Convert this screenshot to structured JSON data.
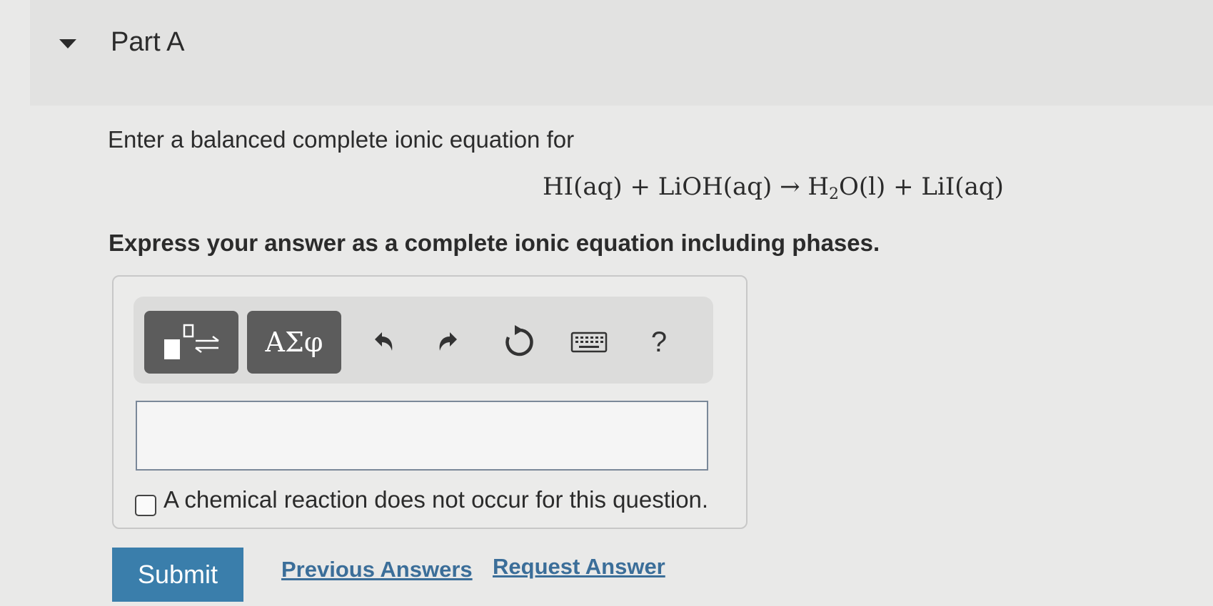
{
  "part": {
    "title": "Part A"
  },
  "question": {
    "prompt": "Enter a balanced complete ionic equation for",
    "equation": {
      "before_sub": "HI(aq) + LiOH(aq) → H",
      "subscript": "2",
      "after_sub": "O(l) + LiI(aq)"
    },
    "instruction": "Express your answer as a complete ionic equation including phases."
  },
  "toolbar": {
    "symbols_label": "ΑΣφ",
    "help_label": "?",
    "icons": [
      "templates-icon",
      "undo-icon",
      "redo-icon",
      "reset-icon",
      "keyboard-icon",
      "help-icon"
    ]
  },
  "answer": {
    "value": "",
    "checkbox_label": "A chemical reaction does not occur for this question.",
    "checkbox_checked": false
  },
  "actions": {
    "submit_label": "Submit",
    "previous_answers_label": "Previous Answers",
    "request_answer_label": "Request Answer"
  },
  "colors": {
    "submit_bg": "#3a7eab",
    "link": "#3b6e99",
    "toolbar_button": "#5c5c5c"
  }
}
